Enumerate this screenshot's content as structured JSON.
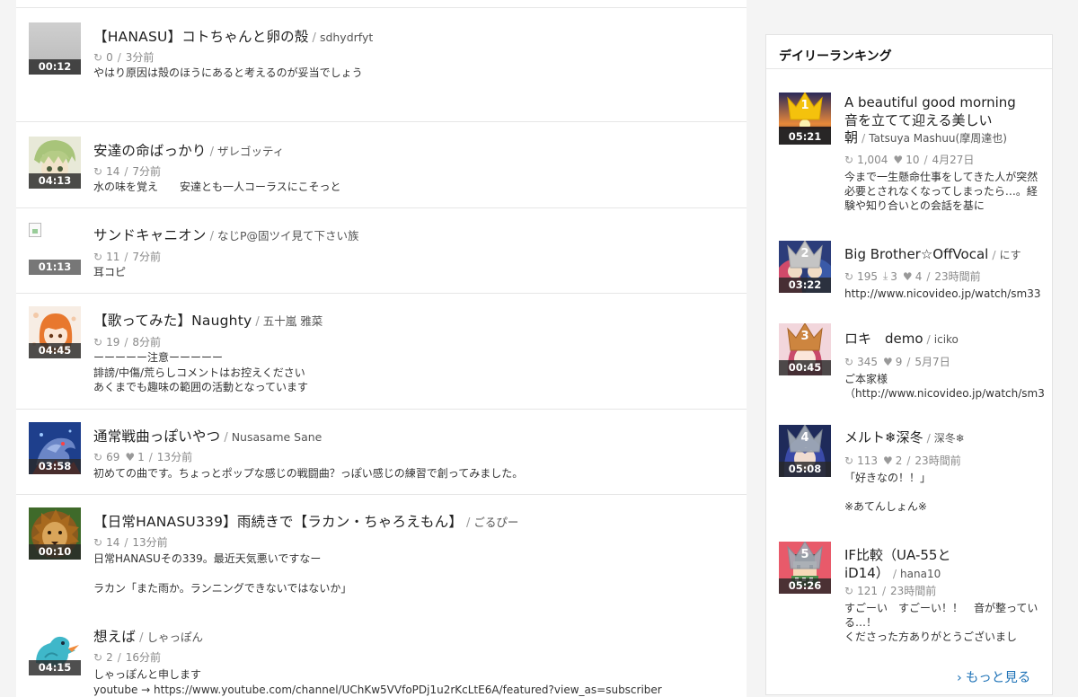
{
  "feed": {
    "items": [
      {
        "title": "【HANASU】コトちゃんと卵の殻",
        "author": "sdhydrfyt",
        "duration": "00:12",
        "plays": "0",
        "time": "3分前",
        "description": "やはり原因は殻のほうにあると考えるのが妥当でしょう"
      },
      {
        "title": "安達の命ばっかり",
        "author": "ザレゴッティ",
        "duration": "04:13",
        "plays": "14",
        "time": "7分前",
        "description": "水の味を覚え　　安達とも一人コーラスにこそっと"
      },
      {
        "title": "サンドキャニオン",
        "author": "なじP@固ツイ見て下さい族",
        "duration": "01:13",
        "plays": "11",
        "time": "7分前",
        "description": "耳コピ"
      },
      {
        "title": "【歌ってみた】Naughty",
        "author": "五十嵐 雅菜",
        "duration": "04:45",
        "plays": "19",
        "time": "8分前",
        "description": "ーーーーー注意ーーーーー\n誹謗/中傷/荒らしコメントはお控えください\nあくまでも趣味の範囲の活動となっています"
      },
      {
        "title": "通常戦曲っぽいやつ",
        "author": "Nusasame Sane",
        "duration": "03:58",
        "plays": "69",
        "likes": "1",
        "time": "13分前",
        "description": "初めての曲です。ちょっとポップな感じの戦闘曲？っぽい感じの練習で創ってみました。"
      },
      {
        "title": "【日常HANASU339】雨続きで【ラカン・ちゃろえもん】",
        "author": "ごるぴー",
        "duration": "00:10",
        "plays": "14",
        "time": "13分前",
        "description": "日常HANASUその339。最近天気悪いですなー\n\nラカン「また雨か。ランニングできないではないか」"
      },
      {
        "title": "想えば",
        "author": "しゃっぽん",
        "duration": "04:15",
        "plays": "2",
        "time": "16分前",
        "description": "しゃっぽんと申します\nyoutube → https://www.youtube.com/channel/UChKw5VVfoPDj1u2rKcLtE6A/featured?view_as=subscriber"
      }
    ]
  },
  "ranking": {
    "header": "デイリーランキング",
    "more_label": "もっと見る",
    "items": [
      {
        "rank": "1",
        "title": "A beautiful good morning　　　音を立てて迎える美しい朝",
        "author": "Tatsuya Mashuu(摩周達也)",
        "duration": "05:21",
        "plays": "1,004",
        "likes": "10",
        "time": "4月27日",
        "description": "今まで一生懸命仕事をしてきた人が突然必要とされなくなってしまったら…。経験や知り合いとの会話を基に",
        "crown_color": "#f4c20d"
      },
      {
        "rank": "2",
        "title": "Big Brother☆OffVocal",
        "author": "にす",
        "duration": "03:22",
        "plays": "195",
        "downloads": "3",
        "likes": "4",
        "time": "23時間前",
        "description": "http://www.nicovideo.jp/watch/sm33",
        "crown_color": "#b9b9b9"
      },
      {
        "rank": "3",
        "title": "ロキ　demo",
        "author": "iciko",
        "duration": "00:45",
        "plays": "345",
        "likes": "9",
        "time": "5月7日",
        "description": "ご本家様\n（http://www.nicovideo.jp/watch/sm3",
        "crown_color": "#c9813a"
      },
      {
        "rank": "4",
        "title": "メルト❄深冬",
        "author": "深冬❄",
        "duration": "05:08",
        "plays": "113",
        "likes": "2",
        "time": "23時間前",
        "description": "「好きなの！！」\n\n※あてんしょん※",
        "crown_color": "#9aa4b0"
      },
      {
        "rank": "5",
        "title": "IF比較（UA-55とiD14）",
        "author": "hana10",
        "duration": "05:26",
        "plays": "121",
        "time": "23時間前",
        "description": "すごーい　すごーい！！　音が整っている…！\nくださった方ありがとうございまし",
        "crown_color": "#9aa4b0"
      }
    ]
  }
}
